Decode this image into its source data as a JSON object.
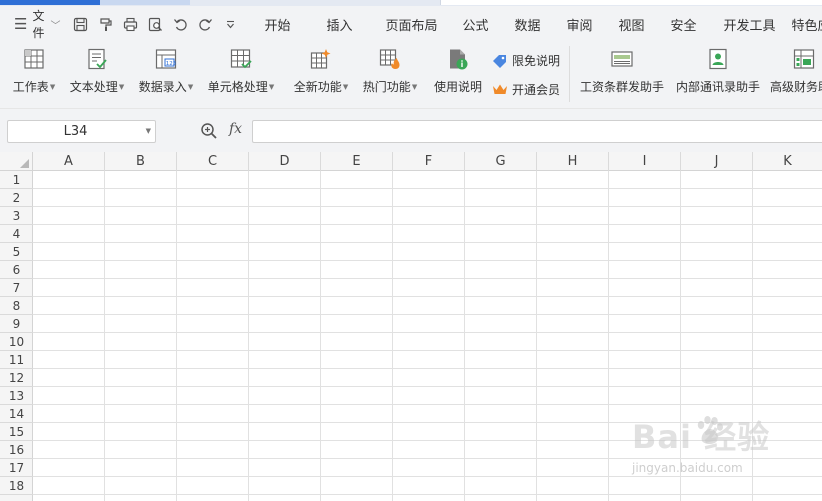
{
  "menubar": {
    "file_label": "文件",
    "quick_access_icons": [
      "save-icon",
      "format-painter-icon",
      "print-icon",
      "print-preview-icon",
      "undo-icon",
      "redo-icon",
      "customize-icon"
    ],
    "tabs": [
      "开始",
      "插入",
      "页面布局",
      "公式",
      "数据",
      "审阅",
      "视图",
      "安全",
      "开发工具",
      "特色应"
    ]
  },
  "ribbon": {
    "worksheet": "工作表",
    "text_processing": "文本处理",
    "data_entry": "数据录入",
    "cell_processing": "单元格处理",
    "new_features": "全新功能",
    "hot_features": "热门功能",
    "usage_guide": "使用说明",
    "free_trial": "限免说明",
    "membership": "开通会员",
    "payroll_helper": "工资条群发助手",
    "contacts_helper": "内部通讯录助手",
    "finance_helper": "高级财务助"
  },
  "formula_bar": {
    "name_box_value": "L34",
    "fx_label": "fx",
    "formula_value": ""
  },
  "sheet": {
    "columns": [
      "A",
      "B",
      "C",
      "D",
      "E",
      "F",
      "G",
      "H",
      "I",
      "J",
      "K"
    ],
    "rows": [
      "1",
      "2",
      "3",
      "4",
      "5",
      "6",
      "7",
      "8",
      "9",
      "10",
      "11",
      "12",
      "13",
      "14",
      "15",
      "16",
      "17",
      "18"
    ]
  },
  "watermark": {
    "main": "Bai  经验",
    "sub": "jingyan.baidu.com"
  },
  "colors": {
    "accent": "#2f6fd6",
    "toolbar_bg": "#f2f3f5",
    "vip_orange": "#f08a2a"
  }
}
